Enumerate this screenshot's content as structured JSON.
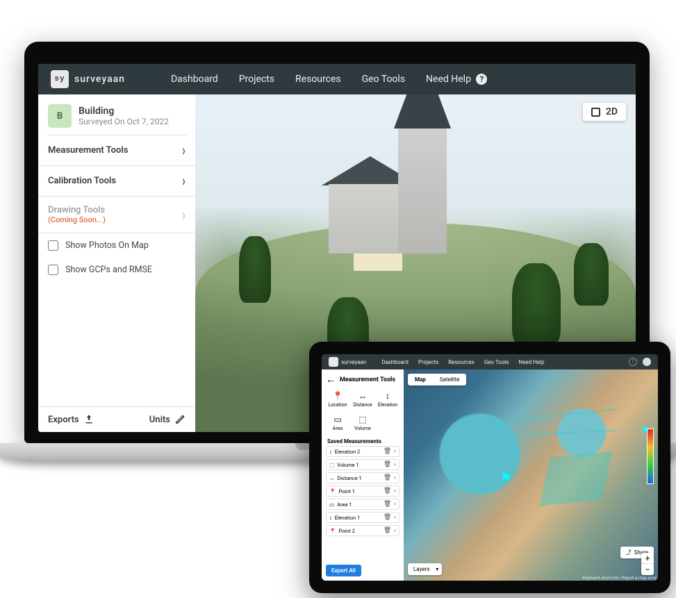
{
  "laptop": {
    "brand": "surveyaan",
    "nav": [
      "Dashboard",
      "Projects",
      "Resources",
      "Geo Tools",
      "Need Help"
    ],
    "project": {
      "badge": "B",
      "title": "Building",
      "subtitle": "Surveyed On Oct 7, 2022"
    },
    "tools": {
      "measurement": "Measurement Tools",
      "calibration": "Calibration Tools",
      "drawing": "Drawing Tools",
      "drawing_soon": "(Coming Soon...)"
    },
    "checks": {
      "photos": "Show Photos On Map",
      "gcps": "Show GCPs and RMSE"
    },
    "footer": {
      "exports": "Exports",
      "units": "Units"
    },
    "view_badge": "2D"
  },
  "tablet": {
    "brand": "surveyaan",
    "nav": [
      "Dashboard",
      "Projects",
      "Resources",
      "Geo Tools",
      "Need Help"
    ],
    "side_title": "Measurement Tools",
    "tool_cells": [
      {
        "icon": "📍",
        "label": "Location"
      },
      {
        "icon": "↔",
        "label": "Distance"
      },
      {
        "icon": "↕",
        "label": "Elevation"
      },
      {
        "icon": "▭",
        "label": "Area"
      },
      {
        "icon": "⬚",
        "label": "Volume"
      }
    ],
    "saved_label": "Saved Measurements",
    "saved": [
      {
        "icon": "↕",
        "name": "Elevation 2"
      },
      {
        "icon": "⬚",
        "name": "Volume 1"
      },
      {
        "icon": "↔",
        "name": "Distance 1"
      },
      {
        "icon": "📍",
        "name": "Point 1"
      },
      {
        "icon": "▭",
        "name": "Area 1"
      },
      {
        "icon": "↕",
        "name": "Elevation 1"
      },
      {
        "icon": "📍",
        "name": "Point 2"
      }
    ],
    "export_all": "Export All",
    "map_tabs": {
      "map": "Map",
      "satellite": "Satellite"
    },
    "layers": "Layers",
    "share": "Share",
    "zoom_in": "+",
    "zoom_out": "−",
    "attribution": "Keyboard shortcuts | Report a map error"
  }
}
